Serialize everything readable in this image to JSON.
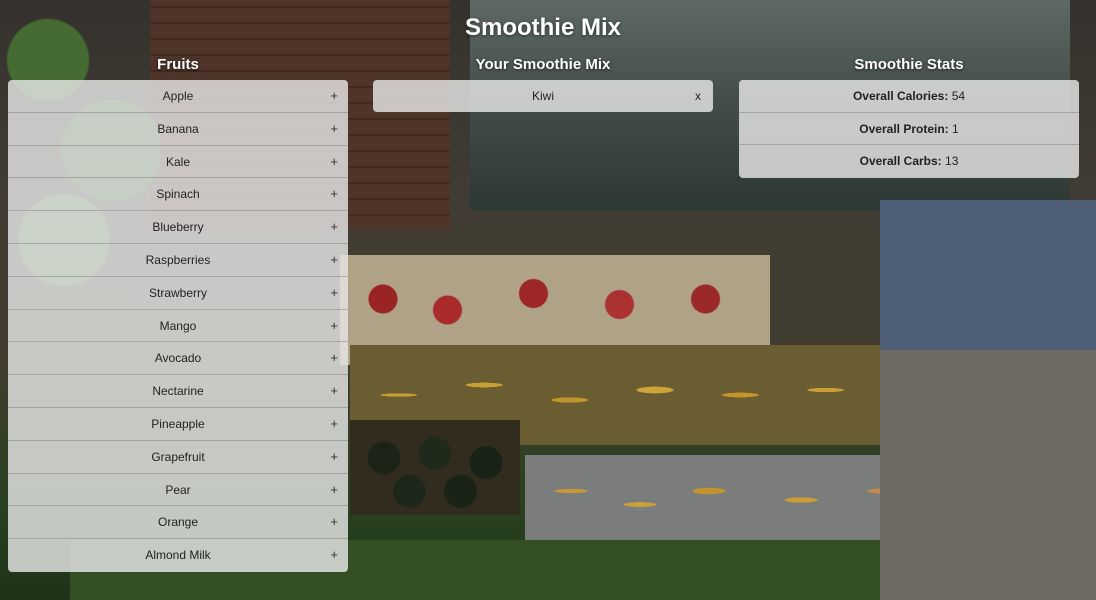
{
  "app": {
    "title": "Smoothie Mix"
  },
  "columns": {
    "fruits": "Fruits",
    "mix": "Your Smoothie Mix",
    "stats": "Smoothie Stats"
  },
  "fruits": [
    "Apple",
    "Banana",
    "Kale",
    "Spinach",
    "Blueberry",
    "Raspberries",
    "Strawberry",
    "Mango",
    "Avocado",
    "Nectarine",
    "Pineapple",
    "Grapefruit",
    "Pear",
    "Orange",
    "Almond Milk"
  ],
  "add_glyph": "+",
  "mix": [
    {
      "name": "Kiwi",
      "remove_glyph": "x"
    }
  ],
  "stats": [
    {
      "label": "Overall Calories:",
      "value": "54"
    },
    {
      "label": "Overall Protein:",
      "value": "1"
    },
    {
      "label": "Overall Carbs:",
      "value": "13"
    }
  ]
}
